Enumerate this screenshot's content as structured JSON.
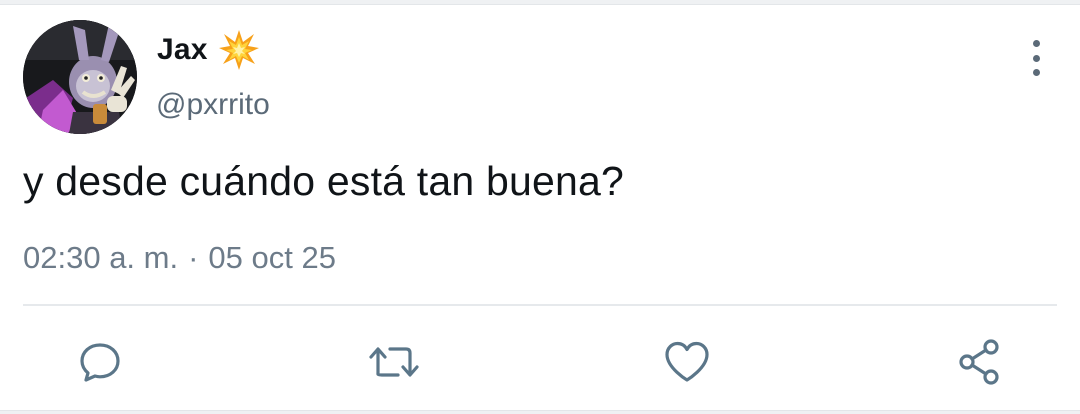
{
  "tweet": {
    "author": {
      "display_name": "Jax",
      "name_emoji": "collision-emoji",
      "handle": "@pxrrito",
      "avatar": "avatar-jax-rabbit-character"
    },
    "text": "y desde cuándo está tan buena?",
    "time": "02:30 a. m.",
    "separator": "·",
    "date": "05 oct 25"
  },
  "actions": [
    {
      "icon": "reply-icon"
    },
    {
      "icon": "retweet-icon"
    },
    {
      "icon": "like-icon"
    },
    {
      "icon": "share-icon"
    }
  ],
  "menu": {
    "icon": "more-vertical-icon"
  },
  "colors": {
    "text_primary": "#101418",
    "text_secondary": "#5b6a78",
    "icon": "#5b7689",
    "divider": "#e6e9ec"
  }
}
